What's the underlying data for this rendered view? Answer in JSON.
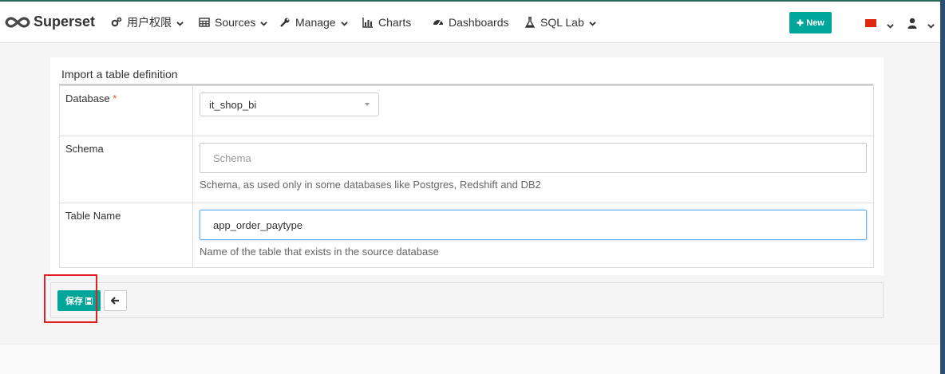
{
  "brand": {
    "name": "Superset",
    "logo_icon": "infinity-logo-icon"
  },
  "nav": [
    {
      "label": "用户权限",
      "icon": "cogs-icon",
      "has_caret": true
    },
    {
      "label": "Sources",
      "icon": "table-icon",
      "has_caret": true
    },
    {
      "label": "Manage",
      "icon": "wrench-icon",
      "has_caret": true
    },
    {
      "label": "Charts",
      "icon": "bar-chart-icon",
      "has_caret": false
    },
    {
      "label": "Dashboards",
      "icon": "dashboard-icon",
      "has_caret": false
    },
    {
      "label": "SQL Lab",
      "icon": "flask-icon",
      "has_caret": true
    }
  ],
  "new_button": {
    "label": "New",
    "icon": "plus-icon"
  },
  "language_flag": "china-flag-icon",
  "user_menu_icon": "user-icon",
  "form": {
    "title": "Import a table definition",
    "database": {
      "label": "Database",
      "required_mark": "*",
      "value": "it_shop_bi"
    },
    "schema": {
      "label": "Schema",
      "placeholder": "Schema",
      "value": "",
      "help": "Schema, as used only in some databases like Postgres, Redshift and DB2"
    },
    "table_name": {
      "label": "Table Name",
      "value": "app_order_paytype",
      "help": "Name of the table that exists in the source database"
    }
  },
  "actions": {
    "save_label": "保存",
    "save_icon": "floppy-disk-icon",
    "back_icon": "arrow-left-icon"
  },
  "colors": {
    "accent": "#00a699",
    "highlight": "#e02020",
    "required": "#d9534f"
  }
}
